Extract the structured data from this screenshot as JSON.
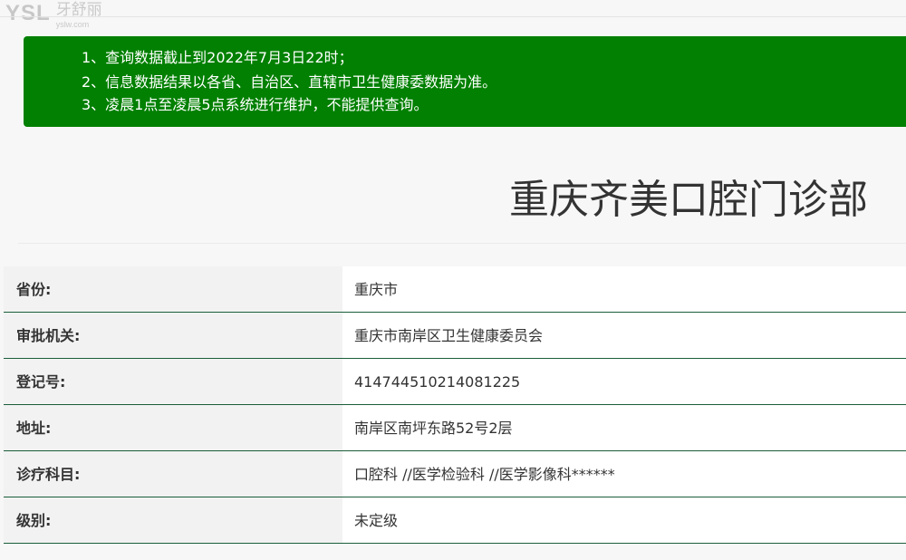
{
  "logo": {
    "mark": "YSL",
    "name": "牙舒丽",
    "url": "yslw.com"
  },
  "notice": {
    "lines": [
      "1、查询数据截止到2022年7月3日22时；",
      "2、信息数据结果以各省、自治区、直辖市卫生健康委数据为准。",
      "3、凌晨1点至凌晨5点系统进行维护，不能提供查询。"
    ]
  },
  "clinic": {
    "title": "重庆齐美口腔门诊部"
  },
  "info_rows": [
    {
      "label": "省份:",
      "value": "重庆市"
    },
    {
      "label": "审批机关:",
      "value": "重庆市南岸区卫生健康委员会"
    },
    {
      "label": "登记号:",
      "value": "414744510214081225"
    },
    {
      "label": "地址:",
      "value": "南岸区南坪东路52号2层"
    },
    {
      "label": "诊疗科目:",
      "value": "口腔科 //医学检验科 //医学影像科******"
    },
    {
      "label": "级别:",
      "value": "未定级"
    }
  ],
  "colors": {
    "notice_bg": "#018001",
    "row_divider": "#1b5e3a"
  }
}
